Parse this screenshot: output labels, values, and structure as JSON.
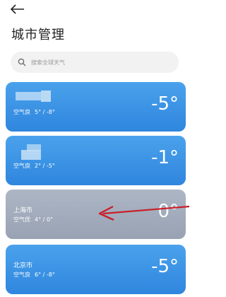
{
  "header": {
    "back_icon": "arrow-left-icon",
    "title": "城市管理"
  },
  "search": {
    "icon": "search-icon",
    "placeholder": "搜索全球天气"
  },
  "cities": [
    {
      "name": "",
      "quality": "空气良",
      "range": "5° / -8°",
      "temp": "-5°",
      "selected": false
    },
    {
      "name": "",
      "quality": "空气良",
      "range": "2° / -5°",
      "temp": "-1°",
      "selected": false
    },
    {
      "name": "上海市",
      "quality": "空气优",
      "range": "4° / 0°",
      "temp": "0°",
      "selected": true
    },
    {
      "name": "北京市",
      "quality": "空气良",
      "range": "6° / -8°",
      "temp": "-5°",
      "selected": false
    }
  ],
  "colors": {
    "card_blue": "#3d95e6",
    "card_gray": "#a3adbd",
    "annotation_arrow": "#c8202a"
  }
}
